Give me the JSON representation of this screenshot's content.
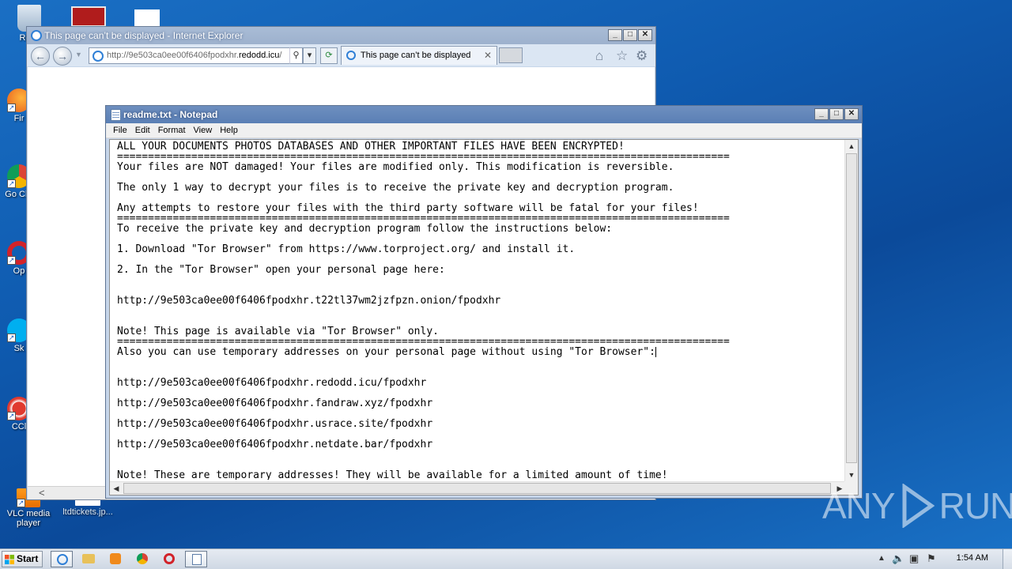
{
  "desktop": {
    "icons": [
      {
        "label": "Recy",
        "icon": "recycle-bin-icon"
      },
      {
        "label": "Fir",
        "icon": "firefox-icon"
      },
      {
        "label": "Go Chr",
        "icon": "chrome-icon"
      },
      {
        "label": "Op",
        "icon": "opera-icon"
      },
      {
        "label": "Sk",
        "icon": "skype-icon"
      },
      {
        "label": "CCl",
        "icon": "ccleaner-icon"
      },
      {
        "label": "VLC media player",
        "icon": "vlc-icon"
      },
      {
        "label": "ltdtickets.jp...",
        "icon": "file-icon"
      }
    ]
  },
  "ie": {
    "title": "This page can’t be displayed - Internet Explorer",
    "address_prefix": "http://9e503ca0ee00f6406fpodxhr.",
    "address_domain": "redodd.icu",
    "address_suffix": "/",
    "tab_label": "This page can’t be displayed",
    "tab_close": "✕"
  },
  "notepad": {
    "title": "readme.txt - Notepad",
    "menu": [
      "File",
      "Edit",
      "Format",
      "View",
      "Help"
    ],
    "lines": [
      "ALL YOUR DOCUMENTS PHOTOS DATABASES AND OTHER IMPORTANT FILES HAVE BEEN ENCRYPTED!",
      "===================================================================================================",
      "Your files are NOT damaged! Your files are modified only. This modification is reversible.",
      "",
      "The only 1 way to decrypt your files is to receive the private key and decryption program.",
      "",
      "Any attempts to restore your files with the third party software will be fatal for your files!",
      "===================================================================================================",
      "To receive the private key and decryption program follow the instructions below:",
      "",
      "1. Download \"Tor Browser\" from https://www.torproject.org/ and install it.",
      "",
      "2. In the \"Tor Browser\" open your personal page here:",
      "",
      "",
      "http://9e503ca0ee00f6406fpodxhr.t22tl37wm2jzfpzn.onion/fpodxhr",
      "",
      "",
      "Note! This page is available via \"Tor Browser\" only.",
      "===================================================================================================",
      "Also you can use temporary addresses on your personal page without using \"Tor Browser\":",
      "",
      "",
      "http://9e503ca0ee00f6406fpodxhr.redodd.icu/fpodxhr",
      "",
      "http://9e503ca0ee00f6406fpodxhr.fandraw.xyz/fpodxhr",
      "",
      "http://9e503ca0ee00f6406fpodxhr.usrace.site/fpodxhr",
      "",
      "http://9e503ca0ee00f6406fpodxhr.netdate.bar/fpodxhr",
      "",
      "",
      "Note! These are temporary addresses! They will be available for a limited amount of time!"
    ]
  },
  "taskbar": {
    "start_label": "Start",
    "clock": "1:54 AM"
  },
  "watermark": {
    "left": "ANY",
    "right": "RUN"
  }
}
